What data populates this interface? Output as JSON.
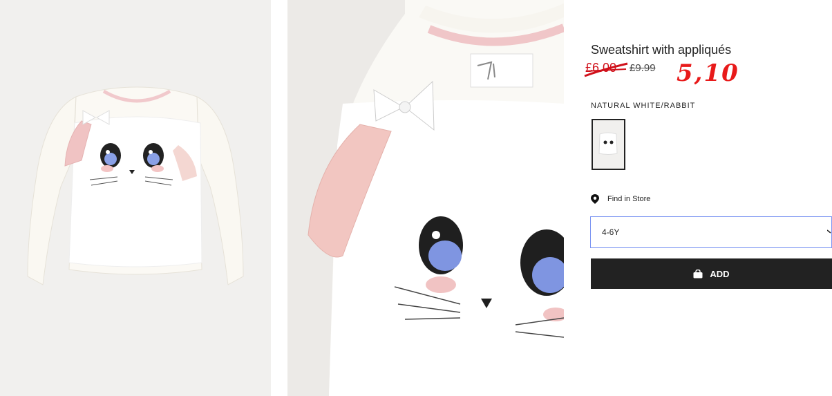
{
  "product": {
    "title": "Sweatshirt with appliqués",
    "price_sale": "£6.00",
    "price_original": "£9.99",
    "handwritten_note": "5,10",
    "color_name": "NATURAL WHITE/RABBIT",
    "selected_size": "4-6Y"
  },
  "actions": {
    "find_in_store": "Find in Store",
    "add_label": "ADD"
  },
  "images": {
    "main": "product-photo-sweatshirt",
    "detail": "product-detail-photo"
  },
  "colors": {
    "sale": "#d0101a",
    "handwritten": "#e81a1a",
    "button": "#222222",
    "select_border": "#7a94f2"
  },
  "icons": [
    "pin-icon",
    "bag-icon",
    "chevron-down-icon"
  ]
}
